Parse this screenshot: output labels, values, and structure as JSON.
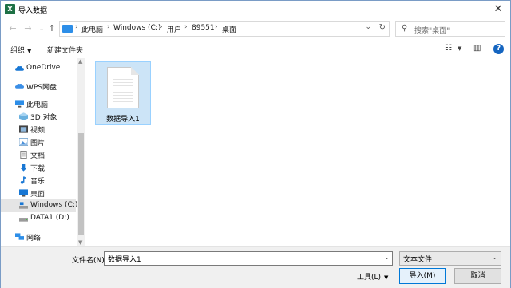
{
  "window": {
    "title": "导入数据",
    "app_icon_letter": "X",
    "close_icon": "close-x"
  },
  "nav": {
    "back_icon": "arrow-left",
    "forward_icon": "arrow-right",
    "recent_icon": "chevron-down",
    "up_icon": "arrow-up",
    "breadcrumbs": [
      "此电脑",
      "Windows (C:)",
      "用户",
      "89551",
      "桌面"
    ],
    "search_placeholder": "搜索\"桌面\""
  },
  "toolbar": {
    "organize_label": "组织",
    "new_folder_label": "新建文件夹"
  },
  "sidebar": {
    "items": [
      {
        "label": "OneDrive",
        "icon": "cloud-icon"
      },
      {
        "label": "WPS网盘",
        "icon": "cloud-icon"
      },
      {
        "label": "此电脑",
        "icon": "computer-icon"
      },
      {
        "label": "3D 对象",
        "icon": "cube-icon"
      },
      {
        "label": "视频",
        "icon": "video-icon"
      },
      {
        "label": "图片",
        "icon": "picture-icon"
      },
      {
        "label": "文档",
        "icon": "document-icon"
      },
      {
        "label": "下载",
        "icon": "download-icon"
      },
      {
        "label": "音乐",
        "icon": "music-icon"
      },
      {
        "label": "桌面",
        "icon": "desktop-icon"
      },
      {
        "label": "Windows (C:)",
        "icon": "drive-icon"
      },
      {
        "label": "DATA1 (D:)",
        "icon": "drive-icon"
      },
      {
        "label": "网络",
        "icon": "network-icon"
      }
    ]
  },
  "files": [
    {
      "name": "数据导入1",
      "icon": "text-document-icon"
    }
  ],
  "footer": {
    "filename_label": "文件名(N):",
    "filename_value": "数据导入1",
    "filetype_value": "文本文件",
    "tools_label": "工具(L)",
    "import_button": "导入(M)",
    "cancel_button": "取消"
  },
  "colors": {
    "accent": "#0078d7",
    "selection": "#cce4f7",
    "excel_green": "#1e7145"
  }
}
